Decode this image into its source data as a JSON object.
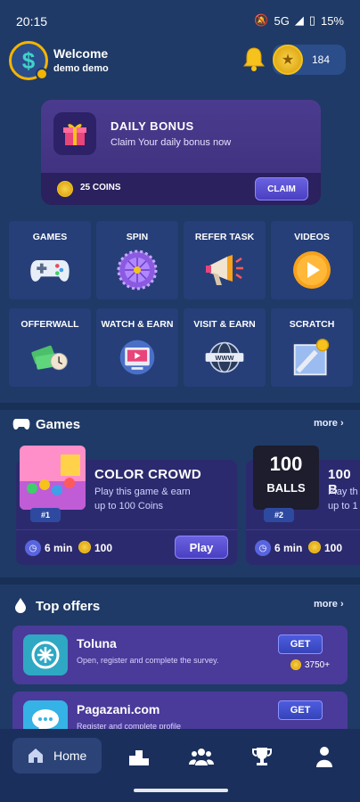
{
  "status_bar": {
    "time": "20:15",
    "network": "5G",
    "battery": "15%"
  },
  "header": {
    "welcome": "Welcome",
    "username": "demo demo",
    "coins": "184"
  },
  "daily_bonus": {
    "title": "DAILY BONUS",
    "subtitle": "Claim Your daily bonus now",
    "coins": "25 COINS",
    "claim_label": "CLAIM"
  },
  "grid": [
    {
      "label": "GAMES",
      "icon": "gamepad-icon"
    },
    {
      "label": "SPIN",
      "icon": "spin-wheel-icon"
    },
    {
      "label": "REFER TASK",
      "icon": "megaphone-icon"
    },
    {
      "label": "VIDEOS",
      "icon": "play-icon"
    },
    {
      "label": "OFFERWALL",
      "icon": "money-icon"
    },
    {
      "label": "WATCH & EARN",
      "icon": "video-icon"
    },
    {
      "label": "VISIT & EARN",
      "icon": "globe-icon"
    },
    {
      "label": "SCRATCH",
      "icon": "scratch-card-icon"
    }
  ],
  "games_section": {
    "title": "Games",
    "more": "more",
    "games": [
      {
        "name": "COLOR CROWD",
        "rank": "#1",
        "desc_line1": "Play this game & earn",
        "desc_line2": "up to 100 Coins",
        "time": "6 min",
        "coins": "100",
        "play_label": "Play"
      },
      {
        "name": "100 B",
        "thumb_text_top": "100",
        "thumb_text_bottom": "BALLS",
        "rank": "#2",
        "desc_line1": "Play th",
        "desc_line2": "up to 1",
        "time": "6 min",
        "coins": "100"
      }
    ]
  },
  "offers_section": {
    "title": "Top offers",
    "more": "more",
    "offers": [
      {
        "name": "Toluna",
        "desc": "Open, register and complete the survey.",
        "get_label": "GET",
        "coins": "3750+",
        "logo_color": "#2fa8c4"
      },
      {
        "name": "Pagazani.com",
        "desc": "Register and complete profile",
        "get_label": "GET",
        "logo_color": "#35b3e6"
      }
    ]
  },
  "bottom_nav": {
    "home_label": "Home"
  },
  "colors": {
    "background": "#1f3a66",
    "tile": "#263f79",
    "card": "#2c2a6e",
    "accent": "#f4b400"
  }
}
